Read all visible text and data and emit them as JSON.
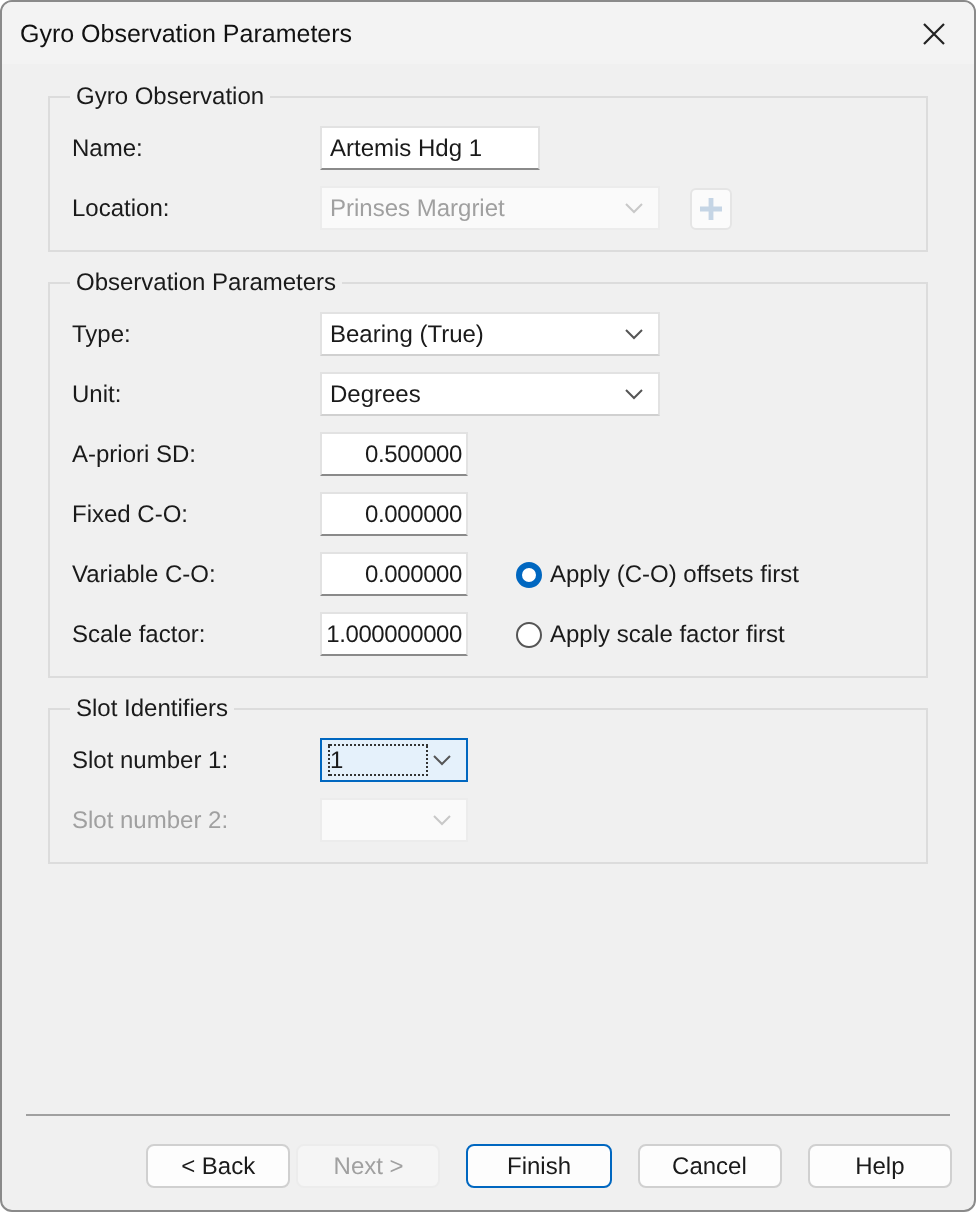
{
  "window": {
    "title": "Gyro Observation Parameters"
  },
  "groups": [
    {
      "title": "Gyro Observation",
      "rows": [
        {
          "label": "Name:",
          "disabled": false,
          "control": {
            "kind": "text",
            "value": "Artemis Hdg 1",
            "disabled": false,
            "focused": false
          }
        },
        {
          "label": "Location:",
          "disabled": false,
          "control": {
            "kind": "combo",
            "value": "Prinses Margriet",
            "disabled": true,
            "focused": false
          },
          "add_button": {
            "disabled": true
          }
        }
      ]
    },
    {
      "title": "Observation Parameters",
      "rows": [
        {
          "label": "Type:",
          "disabled": false,
          "control": {
            "kind": "combo",
            "value": "Bearing (True)",
            "disabled": false,
            "focused": false
          }
        },
        {
          "label": "Unit:",
          "disabled": false,
          "control": {
            "kind": "combo",
            "value": "Degrees",
            "disabled": false,
            "focused": false
          }
        },
        {
          "label": "A-priori SD:",
          "disabled": false,
          "control": {
            "kind": "number",
            "value": "0.500000",
            "disabled": false,
            "focused": false
          }
        },
        {
          "label": "Fixed C-O:",
          "disabled": false,
          "control": {
            "kind": "number",
            "value": "0.000000",
            "disabled": false,
            "focused": false
          }
        },
        {
          "label": "Variable C-O:",
          "disabled": false,
          "control": {
            "kind": "number",
            "value": "0.000000",
            "disabled": false,
            "focused": false
          },
          "radio": {
            "label": "Apply (C-O) offsets first",
            "selected": true
          }
        },
        {
          "label": "Scale factor:",
          "disabled": false,
          "control": {
            "kind": "number",
            "value": "1.000000000",
            "disabled": false,
            "focused": false
          },
          "radio": {
            "label": "Apply scale factor first",
            "selected": false
          }
        }
      ]
    },
    {
      "title": "Slot Identifiers",
      "rows": [
        {
          "label": "Slot number 1:",
          "disabled": false,
          "control": {
            "kind": "smallcombo",
            "value": "1",
            "disabled": false,
            "focused": true
          }
        },
        {
          "label": "Slot number 2:",
          "disabled": true,
          "control": {
            "kind": "smallcombo",
            "disabled": true,
            "focused": false
          }
        }
      ]
    }
  ],
  "buttons": [
    {
      "label": "< Back",
      "disabled": false,
      "default": false
    },
    {
      "label": "Next >",
      "disabled": true,
      "default": false
    },
    {
      "label": "Finish",
      "disabled": false,
      "default": true
    },
    {
      "label": "Cancel",
      "disabled": false,
      "default": false
    },
    {
      "label": "Help",
      "disabled": false,
      "default": false
    }
  ]
}
